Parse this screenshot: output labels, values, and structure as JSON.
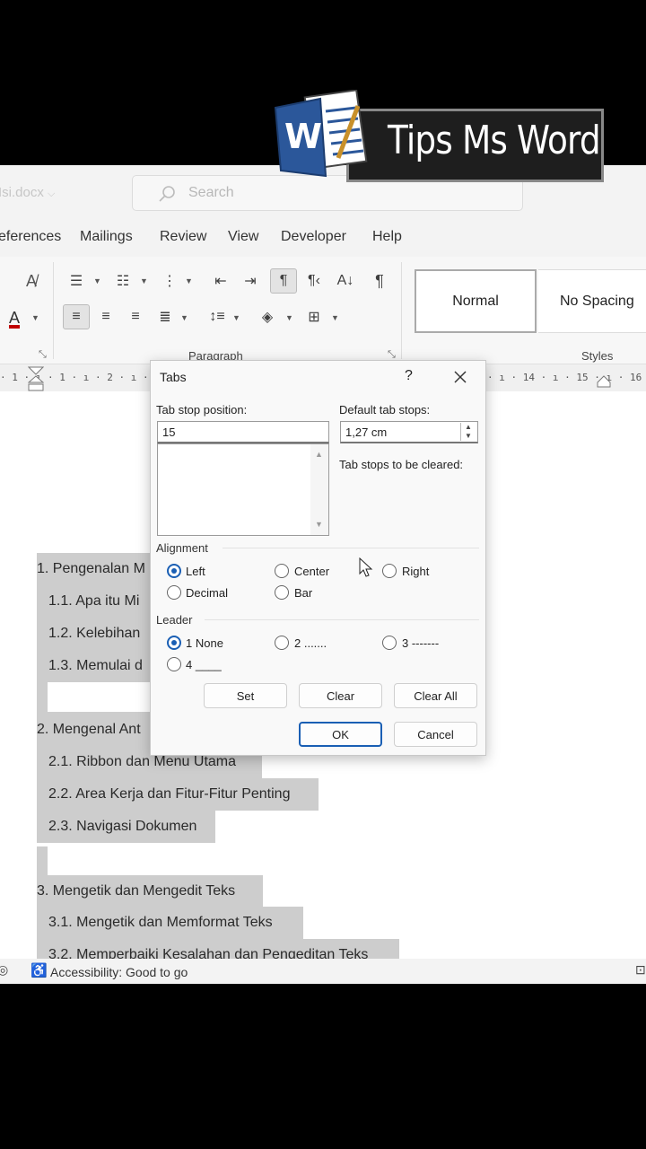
{
  "app": {
    "doc_name": "Isi.docx",
    "search_placeholder": "Search"
  },
  "logo": {
    "badge": "W",
    "text": "Tips Ms Word"
  },
  "menu_tabs": [
    "eferences",
    "Mailings",
    "Review",
    "View",
    "Developer",
    "Help"
  ],
  "ribbon": {
    "paragraph_label": "Paragraph",
    "styles_label": "Styles",
    "styles": [
      "Normal",
      "No Spacing"
    ]
  },
  "ruler": {
    "left_marks": "· 1 · ı · 1 · ı · 2 · ı · 3",
    "right_marks": "· ı · 14 · ı · 15 · ı · 16 ·"
  },
  "document": {
    "lines": [
      "1. Pengenalan M",
      "1.1. Apa itu Mi",
      "1.2. Kelebihan",
      "1.3. Memulai d",
      "",
      "2. Mengenal Ant",
      "2.1. Ribbon dan Menu Utama",
      "2.2. Area Kerja dan Fitur-Fitur Penting",
      "2.3. Navigasi Dokumen",
      "",
      "3. Mengetik dan Mengedit Teks",
      "3.1. Mengetik dan Memformat Teks",
      "3.2. Memperbaiki Kesalahan dan Pengeditan Teks"
    ]
  },
  "status": {
    "accessibility": "Accessibility: Good to go"
  },
  "dialog": {
    "title": "Tabs",
    "help": "?",
    "tab_stop_position_label": "Tab stop position:",
    "tab_stop_position_value": "15",
    "default_tab_stops_label": "Default tab stops:",
    "default_tab_stops_value": "1,27 cm",
    "tab_stops_cleared_label": "Tab stops to be cleared:",
    "alignment_label": "Alignment",
    "alignment_options": [
      "Left",
      "Center",
      "Right",
      "Decimal",
      "Bar"
    ],
    "alignment_selected": "Left",
    "leader_label": "Leader",
    "leader_options": [
      "1 None",
      "2 .......",
      "3 -------",
      "4 ____"
    ],
    "leader_selected": "1 None",
    "buttons": {
      "set": "Set",
      "clear": "Clear",
      "clear_all": "Clear All",
      "ok": "OK",
      "cancel": "Cancel"
    }
  },
  "colors": {
    "accent": "#1a5fb4",
    "word_blue": "#2b579a",
    "highlight": "#cdcdcd"
  }
}
